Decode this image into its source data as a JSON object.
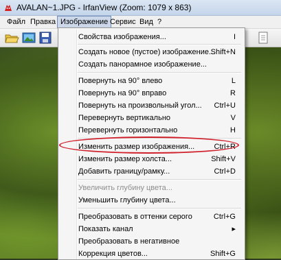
{
  "window": {
    "title": "AVALAN~1.JPG - IrfanView (Zoom: 1079 x 863)",
    "icon": "irfanview-red-cat-icon"
  },
  "menubar": {
    "items": [
      "Файл",
      "Правка",
      "Изображение",
      "Сервис",
      "Вид",
      "?"
    ],
    "active": "Изображение"
  },
  "toolbar": {
    "buttons": [
      "open-folder-icon",
      "slideshow-icon",
      "save-icon",
      "page-icon"
    ]
  },
  "image_menu": {
    "items": [
      {
        "label": "Свойства изображения...",
        "shortcut": "I"
      },
      {
        "label": "Создать новое (пустое) изображение...",
        "shortcut": "Shift+N"
      },
      {
        "label": "Создать панорамное изображение...",
        "shortcut": ""
      },
      {
        "label": "Повернуть на 90° влево",
        "shortcut": "L"
      },
      {
        "label": "Повернуть на 90° вправо",
        "shortcut": "R"
      },
      {
        "label": "Повернуть на произвольный угол...",
        "shortcut": "Ctrl+U"
      },
      {
        "label": "Перевернуть вертикально",
        "shortcut": "V"
      },
      {
        "label": "Перевернуть горизонтально",
        "shortcut": "H"
      },
      {
        "label": "Изменить размер изображения...",
        "shortcut": "Ctrl+R"
      },
      {
        "label": "Изменить размер холста...",
        "shortcut": "Shift+V"
      },
      {
        "label": "Добавить границу/рамку...",
        "shortcut": "Ctrl+D"
      },
      {
        "label": "Увеличить глубину цвета...",
        "shortcut": ""
      },
      {
        "label": "Уменьшить глубину цвета...",
        "shortcut": ""
      },
      {
        "label": "Преобразовать в оттенки серого",
        "shortcut": "Ctrl+G"
      },
      {
        "label": "Показать канал",
        "shortcut": "▸"
      },
      {
        "label": "Преобразовать в негативное",
        "shortcut": ""
      },
      {
        "label": "Коррекция цветов...",
        "shortcut": "Shift+G"
      }
    ],
    "disabled": [
      "Увеличить глубину цвета..."
    ],
    "highlighted_item": "Изменить размер изображения...",
    "highlight_color": "#d0202b"
  }
}
